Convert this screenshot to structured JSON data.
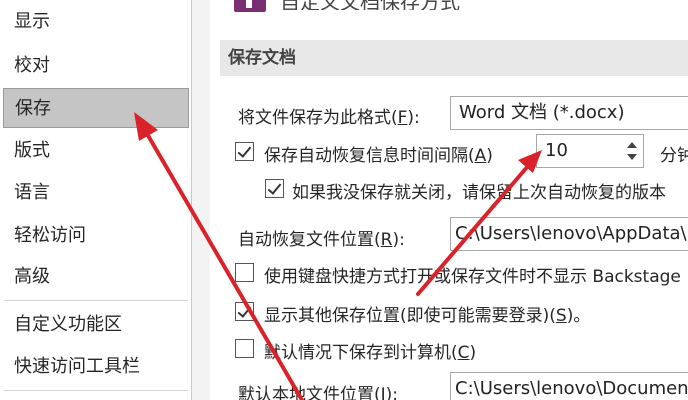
{
  "sidebar": {
    "items": [
      {
        "label": "显示"
      },
      {
        "label": "校对"
      },
      {
        "label": "保存",
        "selected": true
      },
      {
        "label": "版式"
      },
      {
        "label": "语言"
      },
      {
        "label": "轻松访问"
      },
      {
        "label": "高级"
      },
      {
        "label": "自定义功能区"
      },
      {
        "label": "快速访问工具栏"
      }
    ]
  },
  "header": {
    "title": "自定义文档保存方式"
  },
  "section": {
    "title": "保存文档"
  },
  "format": {
    "label": "将文件保存为此格式(",
    "key": "F",
    "label_end": "):",
    "value": "Word 文档 (*.docx)"
  },
  "autorecover": {
    "checked": true,
    "label": "保存自动恢复信息时间间隔(",
    "key": "A",
    "label_end": ")",
    "value": "10",
    "unit": "分钟"
  },
  "keep_last": {
    "checked": true,
    "label": "如果我没保存就关闭，请保留上次自动恢复的版本"
  },
  "autorecover_location": {
    "label": "自动恢复文件位置(",
    "key": "R",
    "label_end": "):",
    "value": "C:\\Users\\lenovo\\AppData\\Roaming"
  },
  "no_backstage": {
    "checked": false,
    "label": "使用键盘快捷方式打开或保存文件时不显示 Backstage"
  },
  "show_other": {
    "checked": true,
    "label": "显示其他保存位置(即使可能需要登录)(",
    "key": "S",
    "label_end": ")。"
  },
  "save_to_computer": {
    "checked": false,
    "label": "默认情况下保存到计算机(",
    "key": "C",
    "label_end": ")"
  },
  "default_location": {
    "label": "默认本地文件位置(",
    "key": "I",
    "label_end": "):",
    "value": "C:\\Users\\lenovo\\Documents"
  },
  "colors": {
    "arrow": "#d9222a",
    "selected": "#c5c5c5"
  }
}
